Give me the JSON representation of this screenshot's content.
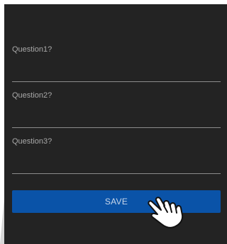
{
  "form": {
    "questions": [
      {
        "label": "Question1?",
        "value": ""
      },
      {
        "label": "Question2?",
        "value": ""
      },
      {
        "label": "Question3?",
        "value": ""
      }
    ],
    "save_label": "SAVE"
  },
  "cursor": {
    "icon": "hand-pointer-icon"
  },
  "colors": {
    "panel_background": "#232323",
    "button": "#0a53a8",
    "label_text": "#a8a8a8",
    "underline": "#8c8c8c"
  }
}
